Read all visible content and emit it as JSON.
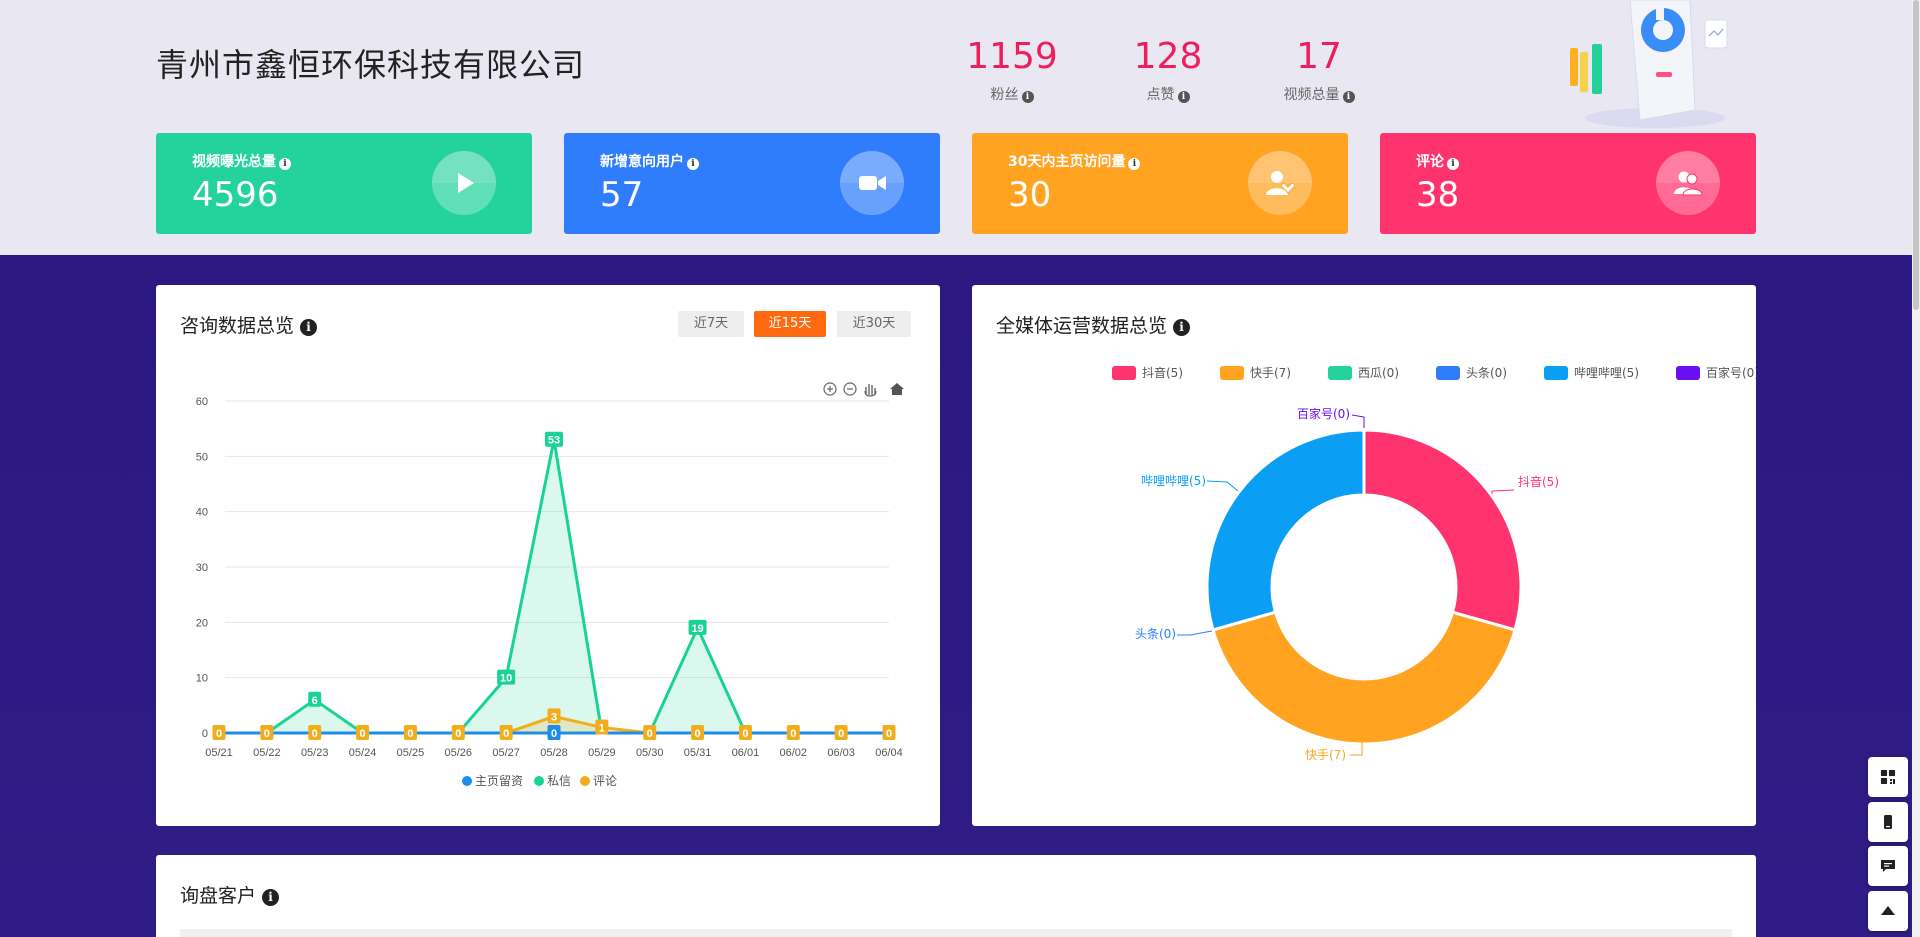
{
  "header": {
    "company": "青州市鑫恒环保科技有限公司",
    "stats": [
      {
        "value": "1159",
        "label": "粉丝"
      },
      {
        "value": "128",
        "label": "点赞"
      },
      {
        "value": "17",
        "label": "视频总量"
      }
    ]
  },
  "cards": [
    {
      "title": "视频曝光总量",
      "value": "4596",
      "color": "#24d39b",
      "icon": "play-icon"
    },
    {
      "title": "新增意向用户",
      "value": "57",
      "color": "#2f7dfc",
      "icon": "video-camera-icon"
    },
    {
      "title": "30天内主页访问量",
      "value": "30",
      "color": "#ffa321",
      "icon": "user-heart-icon"
    },
    {
      "title": "评论",
      "value": "38",
      "color": "#ff336d",
      "icon": "users-icon"
    }
  ],
  "consult": {
    "title": "咨询数据总览",
    "tabs": [
      "近7天",
      "近15天",
      "近30天"
    ],
    "active_tab": 1
  },
  "media": {
    "title": "全媒体运营数据总览"
  },
  "customers": {
    "title": "询盘客户"
  },
  "colors": {
    "homepage": "#1d8de8",
    "dm": "#19d396",
    "comment": "#f0ae1e"
  },
  "chart_data": [
    {
      "type": "line",
      "categories": [
        "05/21",
        "05/22",
        "05/23",
        "05/24",
        "05/25",
        "05/26",
        "05/27",
        "05/28",
        "05/29",
        "05/30",
        "05/31",
        "06/01",
        "06/02",
        "06/03",
        "06/04"
      ],
      "ylim": [
        0,
        60
      ],
      "yticks": [
        "0",
        "10",
        "20",
        "30",
        "40",
        "50",
        "60"
      ],
      "series": [
        {
          "name": "主页留资",
          "values": [
            0,
            0,
            0,
            0,
            0,
            0,
            0,
            0,
            0,
            0,
            0,
            0,
            0,
            0,
            0
          ]
        },
        {
          "name": "私信",
          "values": [
            0,
            0,
            6,
            0,
            0,
            0,
            10,
            53,
            0,
            0,
            19,
            0,
            0,
            0,
            0
          ]
        },
        {
          "name": "评论",
          "values": [
            0,
            0,
            0,
            0,
            0,
            0,
            0,
            3,
            1,
            0,
            0,
            0,
            0,
            0,
            0
          ]
        }
      ],
      "data_labels": [
        {
          "series": 1,
          "index": 2,
          "text": "6"
        },
        {
          "series": 1,
          "index": 6,
          "text": "10"
        },
        {
          "series": 1,
          "index": 7,
          "text": "53"
        },
        {
          "series": 1,
          "index": 10,
          "text": "19"
        },
        {
          "series": 2,
          "index": 7,
          "text": "3"
        },
        {
          "series": 2,
          "index": 8,
          "text": "1"
        },
        {
          "series": 0,
          "index": 7,
          "text": "0"
        },
        {
          "series": 2,
          "index": 0,
          "text": "0"
        },
        {
          "series": 2,
          "index": 1,
          "text": "0"
        },
        {
          "series": 2,
          "index": 2,
          "text": "0"
        },
        {
          "series": 2,
          "index": 3,
          "text": "0"
        },
        {
          "series": 2,
          "index": 4,
          "text": "0"
        },
        {
          "series": 2,
          "index": 5,
          "text": "0"
        },
        {
          "series": 2,
          "index": 6,
          "text": "0"
        },
        {
          "series": 2,
          "index": 9,
          "text": "0"
        },
        {
          "series": 2,
          "index": 10,
          "text": "0"
        },
        {
          "series": 2,
          "index": 11,
          "text": "0"
        },
        {
          "series": 2,
          "index": 12,
          "text": "0"
        },
        {
          "series": 2,
          "index": 13,
          "text": "0"
        },
        {
          "series": 2,
          "index": 14,
          "text": "0"
        }
      ],
      "legend_position": "bottom"
    },
    {
      "type": "pie",
      "series": [
        {
          "name": "抖音",
          "value": 5,
          "color": "#ff336d",
          "label": "抖音(5)"
        },
        {
          "name": "快手",
          "value": 7,
          "color": "#ffa321",
          "label": "快手(7)"
        },
        {
          "name": "西瓜",
          "value": 0,
          "color": "#24d39b",
          "label": "西瓜(0)"
        },
        {
          "name": "头条",
          "value": 0,
          "color": "#2f7dfc",
          "label": "头条(0)"
        },
        {
          "name": "哔哩哔哩",
          "value": 5,
          "color": "#0a9ff5",
          "label": "哔哩哔哩(5)"
        },
        {
          "name": "百家号",
          "value": 0,
          "color": "#6a0ff0",
          "label": "百家号(0)"
        }
      ],
      "slice_labels": {
        "douyin": "抖音(5)",
        "kuaishou": "快手(7)",
        "toutiao": "头条(0)",
        "bilibili": "哔哩哔哩(5)",
        "baijia": "百家号(0)"
      },
      "legend_position": "top"
    }
  ]
}
